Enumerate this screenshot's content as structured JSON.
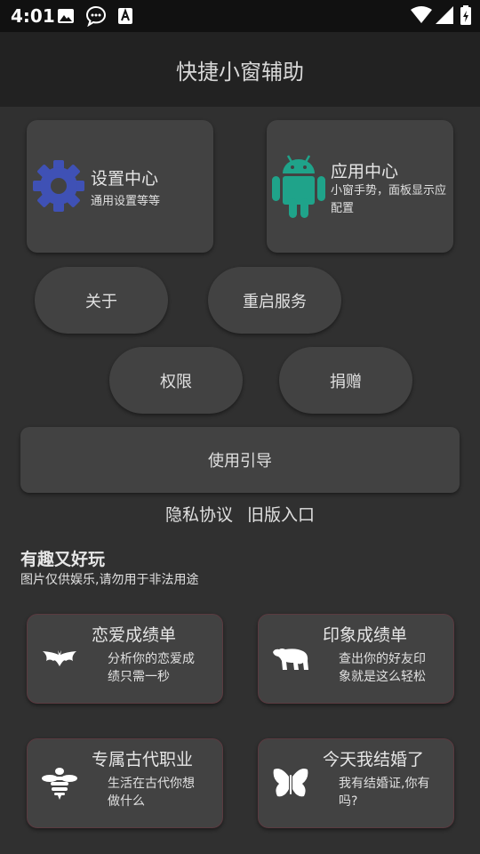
{
  "status_bar": {
    "time": "4:01",
    "left_icons": [
      "image-icon",
      "message-icon",
      "font-icon"
    ],
    "right_icons": [
      "wifi-icon",
      "signal-icon",
      "battery-icon"
    ]
  },
  "app_bar": {
    "title": "快捷小窗辅助"
  },
  "cards": {
    "settings": {
      "title": "设置中心",
      "subtitle": "通用设置等等",
      "icon": "gear-icon",
      "icon_color": "#3F51B5"
    },
    "apps": {
      "title": "应用中心",
      "subtitle": "小窗手势，面板显示应配置",
      "icon": "android-icon",
      "icon_color": "#1FA38A"
    }
  },
  "buttons": {
    "about": "关于",
    "restart": "重启服务",
    "permission": "权限",
    "donate": "捐赠",
    "guide": "使用引导"
  },
  "links": {
    "privacy": "隐私协议",
    "legacy": "旧版入口"
  },
  "fun_section": {
    "title": "有趣又好玩",
    "subtitle": "图片仅供娱乐,请勿用于非法用途",
    "items": [
      {
        "title": "恋爱成绩单",
        "desc": "分析你的恋爱成绩只需一秒",
        "icon": "bat-icon"
      },
      {
        "title": "印象成绩单",
        "desc": "查出你的好友印象就是这么轻松",
        "icon": "bear-icon"
      },
      {
        "title": "专属古代职业",
        "desc": "生活在古代你想做什么",
        "icon": "bee-icon"
      },
      {
        "title": "今天我结婚了",
        "desc": "我有结婚证,你有吗?",
        "icon": "butterfly-icon"
      }
    ]
  }
}
